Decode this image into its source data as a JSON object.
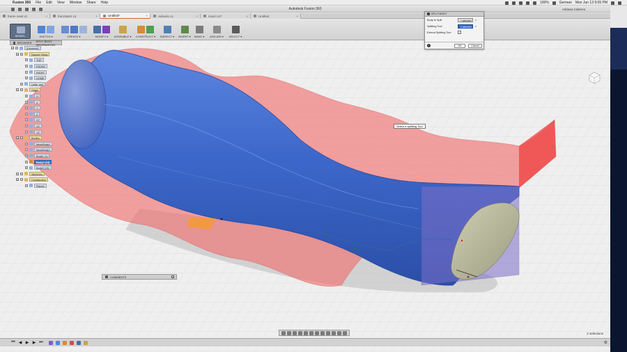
{
  "menubar": {
    "app": "Fusion 360",
    "items": [
      "File",
      "Edit",
      "View",
      "Window",
      "Share",
      "Help"
    ],
    "battery": "100%",
    "input_source": "German",
    "clock": "Mon Jun 13  9:05 PM"
  },
  "window": {
    "title": "Autodesk Fusion 360",
    "user": "Adriana Cabrera"
  },
  "tabs": [
    {
      "label": "frame newt v1",
      "active": false
    },
    {
      "label": "fram3atelr v3",
      "active": false
    },
    {
      "label": "Untitled*",
      "active": true
    },
    {
      "label": "nebeelo v1",
      "active": false
    },
    {
      "label": "insect v2*",
      "active": false
    },
    {
      "label": "Untitled",
      "active": false
    }
  ],
  "ribbon": {
    "workspace": "MODEL",
    "groups": [
      {
        "label": "SKETCH ▾",
        "color": "#4f86d6"
      },
      {
        "label": "CREATE ▾",
        "color": "#6a8fcf"
      },
      {
        "label": "MODIFY ▾",
        "color": "#4a6ea8"
      },
      {
        "label": "ASSEMBLE ▾",
        "color": "#c9a449"
      },
      {
        "label": "CONSTRUCT ▾",
        "color": "#d58b3a"
      },
      {
        "label": "INSPECT ▾",
        "color": "#4f7fb6"
      },
      {
        "label": "INSERT ▾",
        "color": "#5f8a4a"
      },
      {
        "label": "MAKE ▾",
        "color": "#7b7b7b"
      },
      {
        "label": "ADD-INS ▾",
        "color": "#8a8a8a"
      },
      {
        "label": "SELECT ▾",
        "color": "#5b5b5b"
      }
    ]
  },
  "browser": {
    "header": "BROWSER",
    "subheader": "SPLIT BODY INFORMATION",
    "rows": [
      {
        "label": "(Unsaved)",
        "kind": "root",
        "indent": 0
      },
      {
        "label": "Named Views",
        "kind": "folder",
        "indent": 1
      },
      {
        "label": "TOP",
        "kind": "item",
        "indent": 2
      },
      {
        "label": "FRONT",
        "kind": "item",
        "indent": 2
      },
      {
        "label": "RIGHT",
        "kind": "item",
        "indent": 2
      },
      {
        "label": "HOME",
        "kind": "item",
        "indent": 2
      },
      {
        "label": "Units: mm",
        "kind": "item",
        "indent": 1
      },
      {
        "label": "Origin",
        "kind": "folder",
        "indent": 1
      },
      {
        "label": "O",
        "kind": "item",
        "indent": 2
      },
      {
        "label": "X",
        "kind": "item",
        "indent": 2
      },
      {
        "label": "Y",
        "kind": "item",
        "indent": 2
      },
      {
        "label": "Z",
        "kind": "item",
        "indent": 2
      },
      {
        "label": "XY",
        "kind": "item",
        "indent": 2
      },
      {
        "label": "XZ",
        "kind": "item",
        "indent": 2
      },
      {
        "label": "YZ",
        "kind": "item",
        "indent": 2
      },
      {
        "label": "Bodies",
        "kind": "folder",
        "indent": 1
      },
      {
        "label": "MeshBody2",
        "kind": "item",
        "indent": 2
      },
      {
        "label": "MeshBody1",
        "kind": "item",
        "indent": 2
      },
      {
        "label": "Body1 (1)",
        "kind": "item",
        "indent": 2
      },
      {
        "label": "Body2 (13)",
        "kind": "selected",
        "indent": 2
      },
      {
        "label": "Body3 (13)",
        "kind": "item",
        "indent": 2
      },
      {
        "label": "Sketches",
        "kind": "folder",
        "indent": 1
      },
      {
        "label": "Construction",
        "kind": "folder",
        "indent": 1
      },
      {
        "label": "Plane1",
        "kind": "item",
        "indent": 2
      }
    ]
  },
  "split_body": {
    "title": "SPLIT BODY",
    "body_to_split_label": "Body to Split",
    "body_to_split_value": "1 selected",
    "splitting_tool_label": "Splitting Tool",
    "splitting_tool_value": "1 selected",
    "extend_label": "Extend Splitting Tool",
    "extend_checked": "✓",
    "ok": "OK",
    "cancel": "Cancel"
  },
  "tooltip": "Select a splitting Tool",
  "comments": "COMMENTS",
  "status": {
    "selections": "2 selections"
  },
  "timeline": {
    "controls": [
      "⏮",
      "◀",
      "▶",
      "▶",
      "⏭"
    ]
  },
  "colors": {
    "body_blue": "#3c66c7",
    "plane_red": "#f05555",
    "cut_face": "#b8b89a"
  }
}
